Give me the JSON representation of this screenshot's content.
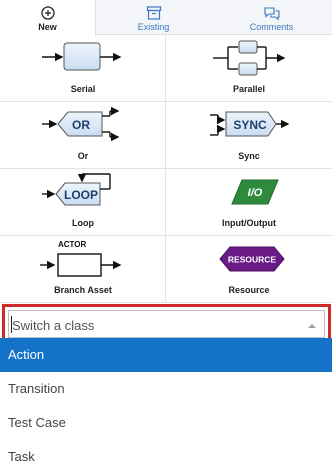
{
  "tabs": [
    {
      "label": "New",
      "icon": "plus-circle-icon",
      "active": true
    },
    {
      "label": "Existing",
      "icon": "archive-icon"
    },
    {
      "label": "Comments",
      "icon": "comments-icon"
    }
  ],
  "palette": {
    "items": [
      {
        "label": "Serial",
        "icon": "serial-shape-icon"
      },
      {
        "label": "Parallel",
        "icon": "parallel-shape-icon"
      },
      {
        "label": "Or",
        "icon": "or-shape-icon",
        "shape_text": "OR"
      },
      {
        "label": "Sync",
        "icon": "sync-shape-icon",
        "shape_text": "SYNC"
      },
      {
        "label": "Loop",
        "icon": "loop-shape-icon",
        "shape_text": "LOOP"
      },
      {
        "label": "Input/Output",
        "icon": "io-shape-icon",
        "shape_text": "I/O"
      },
      {
        "label": "Branch Asset",
        "icon": "actor-shape-icon",
        "shape_text": "ACTOR"
      },
      {
        "label": "Resource",
        "icon": "resource-shape-icon",
        "shape_text": "RESOURCE"
      }
    ]
  },
  "class_select": {
    "placeholder": "Switch a class",
    "options": [
      "Action",
      "Transition",
      "Test Case",
      "Task"
    ],
    "highlighted": "Action"
  },
  "colors": {
    "accent_blue": "#1472c9",
    "tab_link": "#3a79c4",
    "focus_border": "#cf2b2b",
    "io_green": "#2e8b3d",
    "resource_purple": "#6a1b86",
    "shape_fill": "#dbe9f7"
  }
}
